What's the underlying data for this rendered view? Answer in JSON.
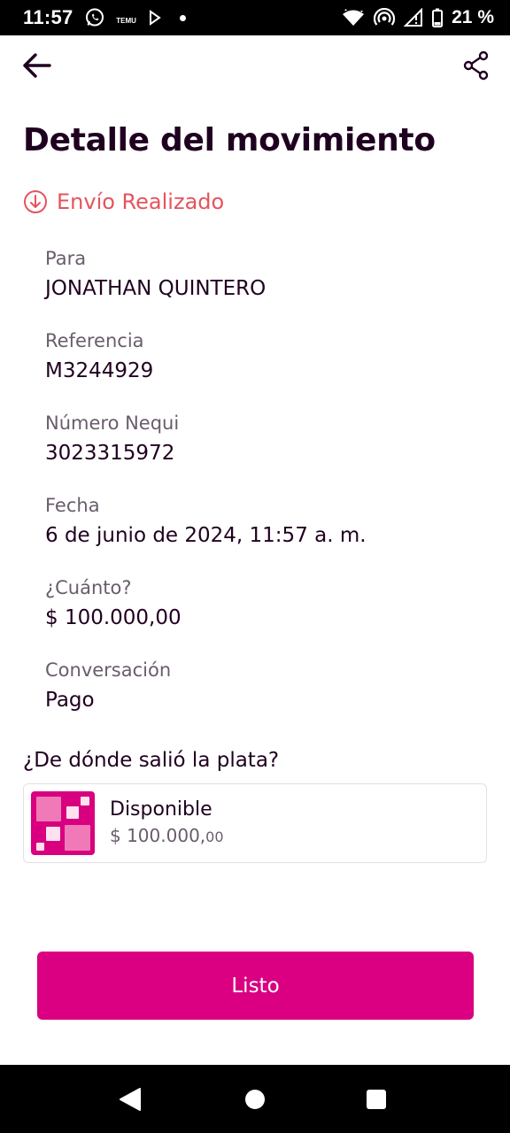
{
  "status_bar": {
    "time": "11:57",
    "temu_label": "TEMU",
    "battery": "21 %"
  },
  "header": {
    "title": "Detalle del movimiento"
  },
  "transaction": {
    "status": "Envío Realizado",
    "status_color": "#e5545d"
  },
  "fields": [
    {
      "label": "Para",
      "value": "JONATHAN QUINTERO"
    },
    {
      "label": "Referencia",
      "value": "M3244929"
    },
    {
      "label": "Número Nequi",
      "value": "3023315972"
    },
    {
      "label": "Fecha",
      "value": "6 de junio de 2024, 11:57 a. m."
    },
    {
      "label": "¿Cuánto?",
      "value": "$ 100.000,00"
    },
    {
      "label": "Conversación",
      "value": "Pago"
    }
  ],
  "source": {
    "question": "¿De dónde salió la plata?",
    "name": "Disponible",
    "amount_main": "$ 100.000,",
    "amount_cents": "00"
  },
  "actions": {
    "done_label": "Listo"
  },
  "colors": {
    "brand": "#da0081",
    "text": "#200020",
    "muted": "#6a5c6c"
  },
  "icons": [
    "whatsapp-icon",
    "temu-icon",
    "play-icon",
    "wifi-icon",
    "hotspot-icon",
    "signal-icon",
    "battery-icon",
    "arrow-left-icon",
    "share-icon",
    "arrow-down-circle-icon",
    "pocket-icon",
    "nav-back-icon",
    "nav-home-icon",
    "nav-recents-icon"
  ]
}
